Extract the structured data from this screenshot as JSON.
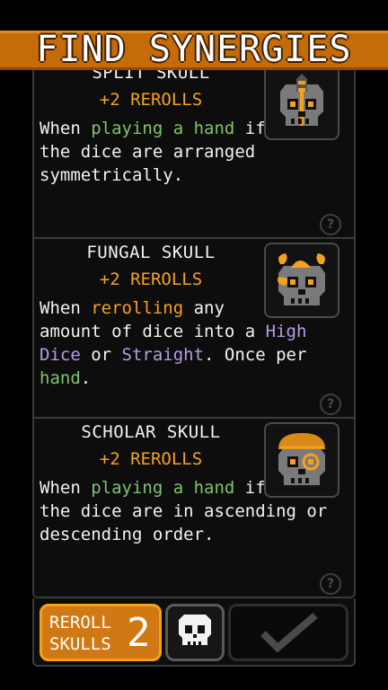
{
  "header": {
    "title": "FIND SYNERGIES"
  },
  "cards": [
    {
      "title": "SPLIT SKULL",
      "bonus": "+2 REROLLS",
      "desc": [
        {
          "t": "When ",
          "c": "plain"
        },
        {
          "t": "playing a hand",
          "c": "green"
        },
        {
          "t": " if\nthe dice are arranged\nsymmetrically.",
          "c": "plain"
        }
      ],
      "portrait_icon": "split-skull-icon"
    },
    {
      "title": "FUNGAL SKULL",
      "bonus": "+2 REROLLS",
      "desc": [
        {
          "t": "When ",
          "c": "plain"
        },
        {
          "t": "rerolling",
          "c": "orange"
        },
        {
          "t": " any\namount of dice into a ",
          "c": "plain"
        },
        {
          "t": "High\nDice",
          "c": "purple"
        },
        {
          "t": " or ",
          "c": "plain"
        },
        {
          "t": "Straight",
          "c": "purple"
        },
        {
          "t": ". Once per\n",
          "c": "plain"
        },
        {
          "t": "hand",
          "c": "green"
        },
        {
          "t": ".",
          "c": "plain"
        }
      ],
      "portrait_icon": "fungal-skull-icon"
    },
    {
      "title": "SCHOLAR SKULL",
      "bonus": "+2 REROLLS",
      "desc": [
        {
          "t": "When ",
          "c": "plain"
        },
        {
          "t": "playing a hand",
          "c": "green"
        },
        {
          "t": " if\nthe dice are in ascending or\ndescending order.",
          "c": "plain"
        }
      ],
      "portrait_icon": "scholar-skull-icon"
    }
  ],
  "help_icon_label": "?",
  "footer": {
    "reroll_label_1": "REROLL",
    "reroll_label_2": "SKULLS",
    "reroll_count": "2"
  },
  "colors": {
    "accent_orange": "#f4a21e",
    "banner_orange": "#c46b0a",
    "green_keyword": "#7fc46a",
    "purple_keyword": "#b69ce6"
  }
}
